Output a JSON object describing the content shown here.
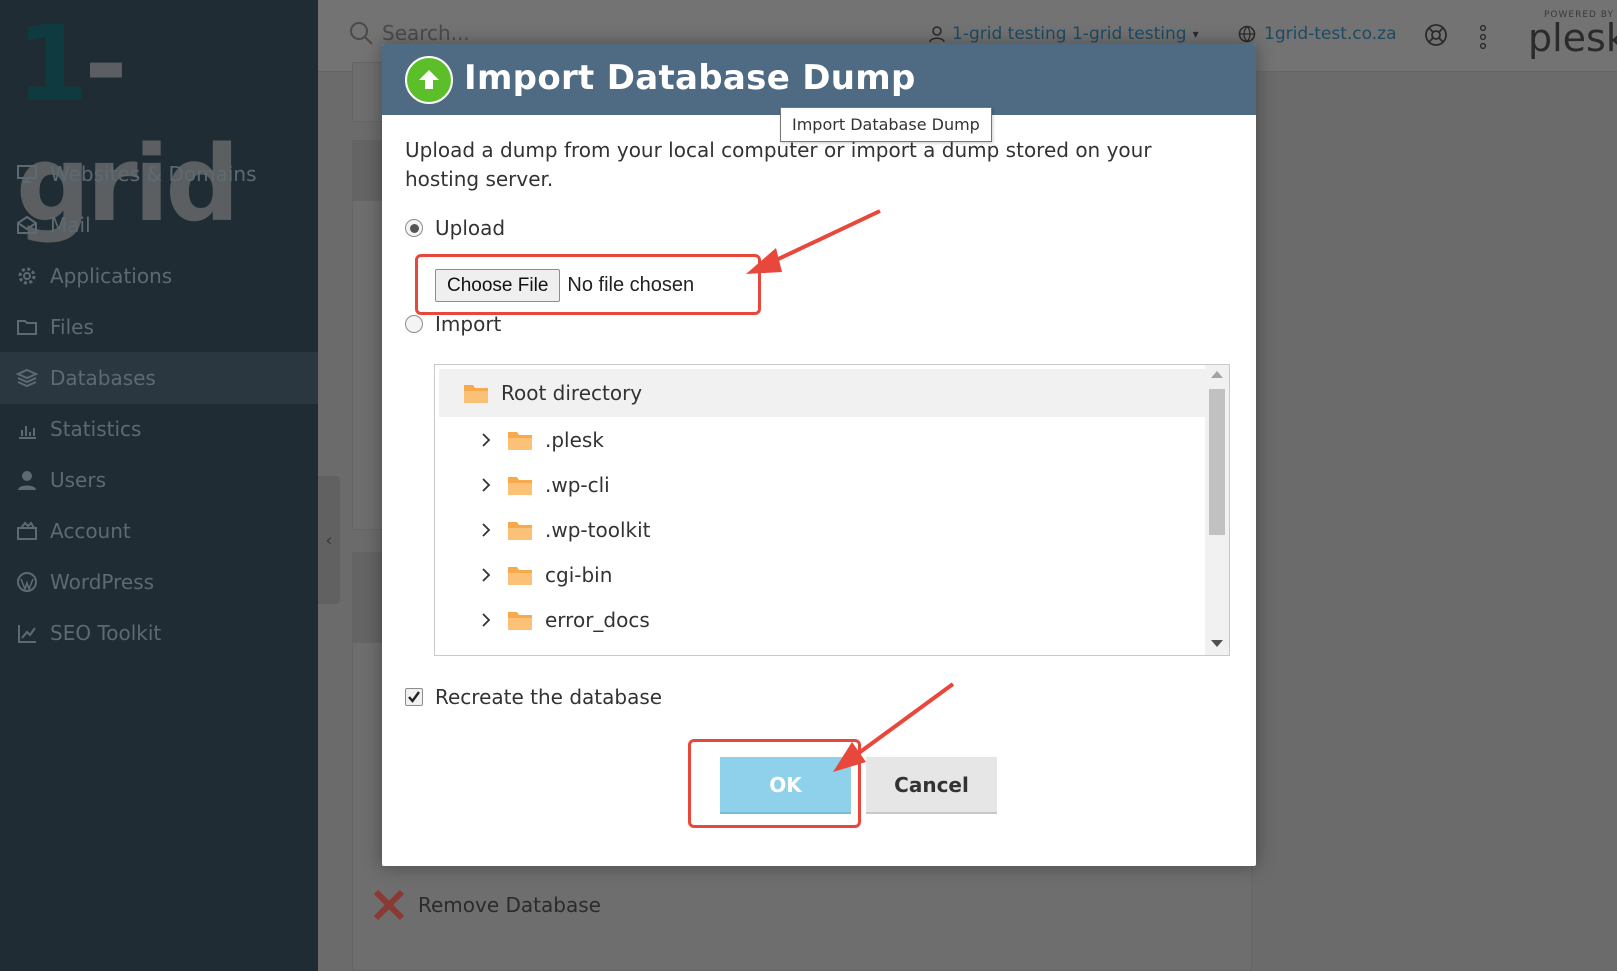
{
  "app": {
    "logo_one": "1",
    "logo_rest": "-grid",
    "search_placeholder": "Search...",
    "user": "1-grid testing 1-grid testing",
    "domain": "1grid-test.co.za",
    "powered_by": "POWERED BY",
    "powered_brand": "plesk"
  },
  "sidebar": {
    "items": [
      {
        "label": "Websites & Domains",
        "icon": "monitor-icon"
      },
      {
        "label": "Mail",
        "icon": "mail-icon"
      },
      {
        "label": "Applications",
        "icon": "gear-icon"
      },
      {
        "label": "Files",
        "icon": "folder-icon"
      },
      {
        "label": "Databases",
        "icon": "layers-icon",
        "active": true
      },
      {
        "label": "Statistics",
        "icon": "bar-chart-icon"
      },
      {
        "label": "Users",
        "icon": "user-icon"
      },
      {
        "label": "Account",
        "icon": "account-icon"
      },
      {
        "label": "WordPress",
        "icon": "wordpress-icon"
      },
      {
        "label": "SEO Toolkit",
        "icon": "seo-chart-icon"
      }
    ]
  },
  "background": {
    "remove_database": "Remove Database"
  },
  "dialog": {
    "title": "Import Database Dump",
    "tooltip": "Import Database Dump",
    "description": "Upload a dump from your local computer or import a dump stored on your hosting server.",
    "upload_label": "Upload",
    "choose_file": "Choose File",
    "no_file": "No file chosen",
    "import_label": "Import",
    "tree": {
      "root": "Root directory",
      "items": [
        ".plesk",
        ".wp-cli",
        ".wp-toolkit",
        "cgi-bin",
        "error_docs"
      ]
    },
    "recreate_label": "Recreate the database",
    "recreate_checked": true,
    "ok": "OK",
    "cancel": "Cancel"
  },
  "colors": {
    "header": "#4f6b83",
    "ok_button": "#8fd0ea",
    "highlight": "#e8473b",
    "folder": "#f7a94b"
  }
}
